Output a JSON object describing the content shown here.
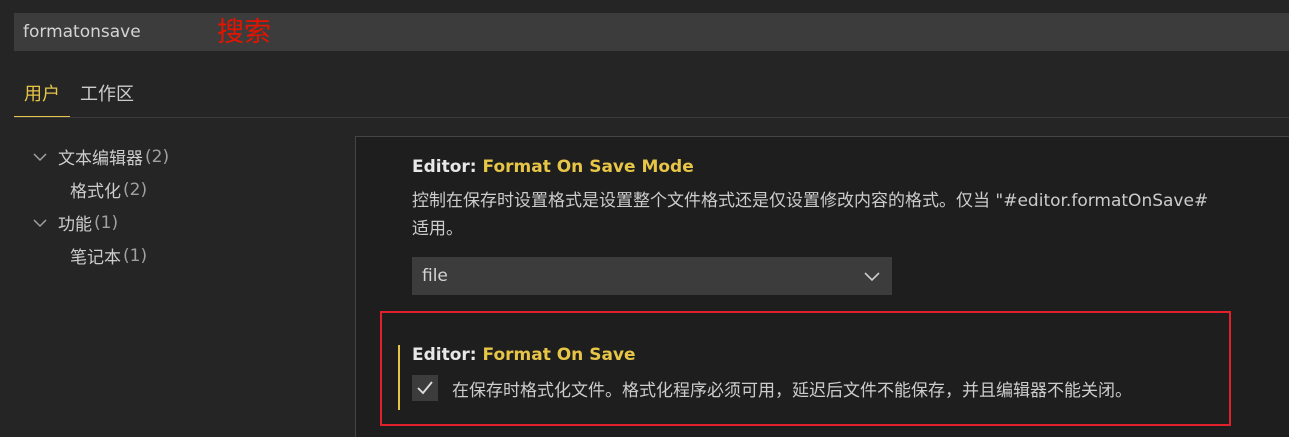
{
  "search": {
    "value": "formatonsave",
    "annotation": "搜索"
  },
  "tabs": [
    {
      "label": "用户",
      "active": true
    },
    {
      "label": "工作区",
      "active": false
    }
  ],
  "tree": [
    {
      "label": "文本编辑器",
      "count": "(2)",
      "expanded": true
    },
    {
      "label": "格式化",
      "count": "(2)",
      "child": true
    },
    {
      "label": "功能",
      "count": "(1)",
      "expanded": true
    },
    {
      "label": "笔记本",
      "count": "(1)",
      "child": true
    }
  ],
  "settings": {
    "format_on_save_mode": {
      "category": "Editor: ",
      "name": "Format On Save Mode",
      "description_line1": "控制在保存时设置格式是设置整个文件格式还是仅设置修改内容的格式。仅当 \"#editor.formatOnSave#",
      "description_line2": "适用。",
      "value": "file"
    },
    "format_on_save": {
      "category": "Editor: ",
      "name": "Format On Save",
      "checked": true,
      "description": "在保存时格式化文件。格式化程序必须可用，延迟后文件不能保存，并且编辑器不能关闭。"
    }
  },
  "colors": {
    "accent": "#e7c547",
    "highlight_border": "#e0202a",
    "annotation": "#e51400",
    "background": "#252526",
    "editor_background": "#1e1e1e"
  }
}
